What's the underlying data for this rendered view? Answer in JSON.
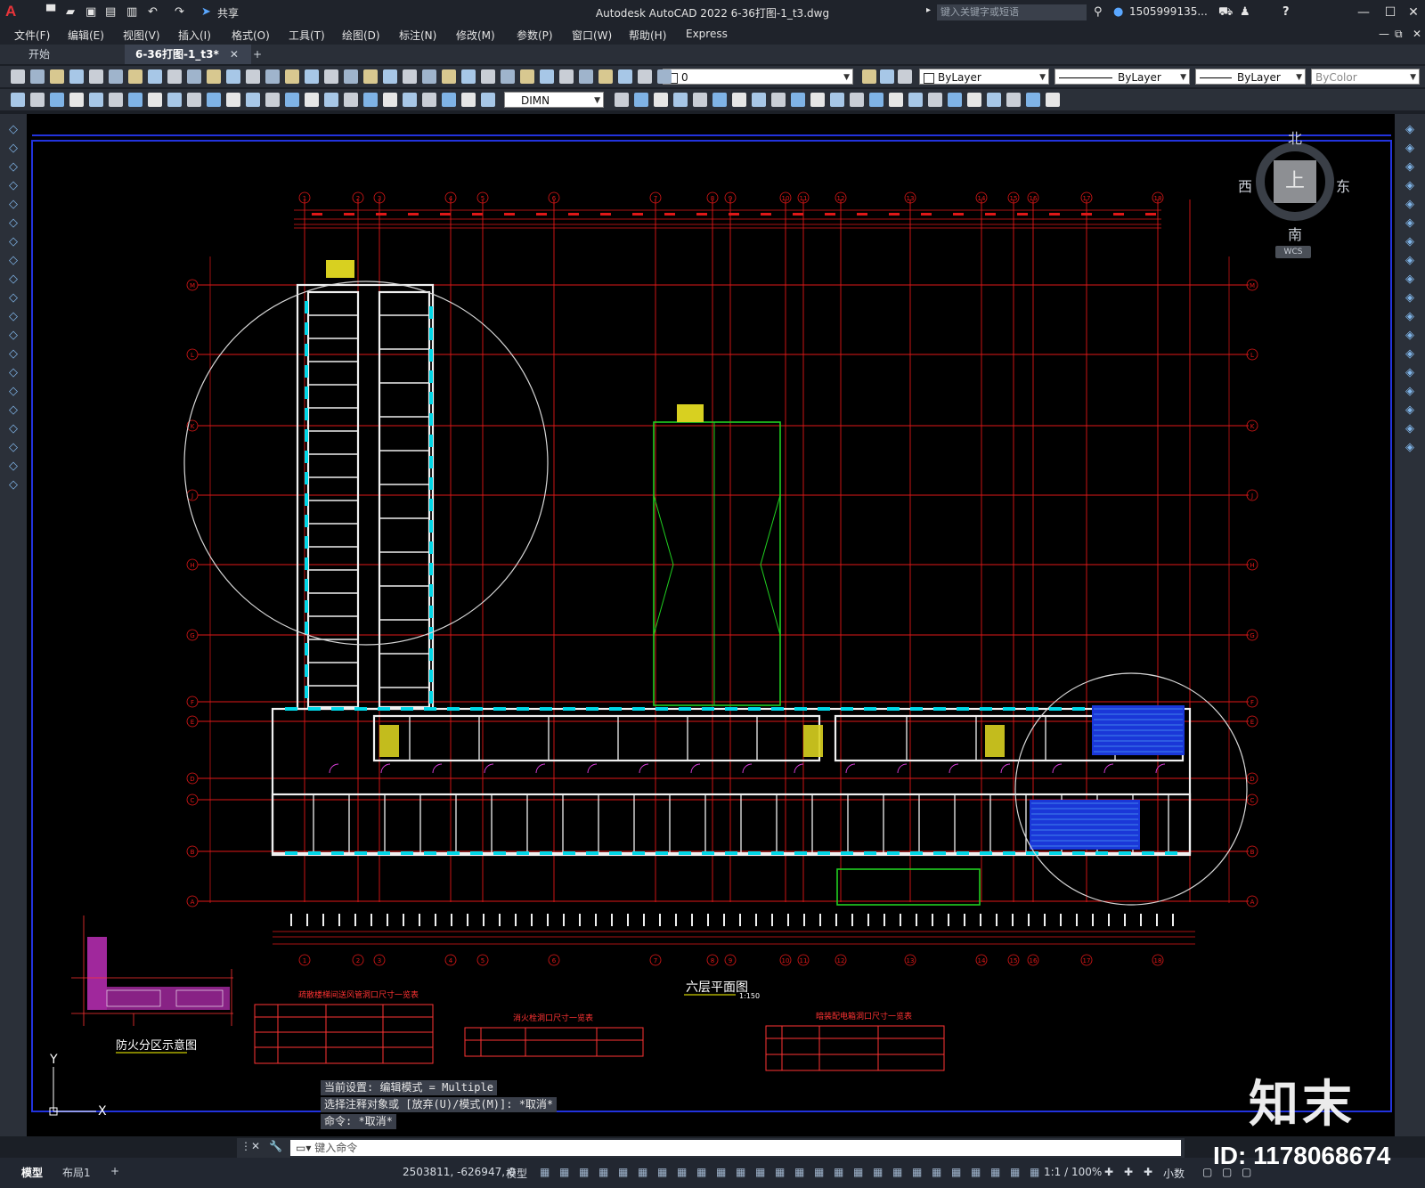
{
  "titlebar": {
    "app_logo": "A",
    "share_label": "共享",
    "title": "Autodesk AutoCAD 2022    6-36打图-1_t3.dwg",
    "search_placeholder": "键入关键字或短语",
    "user": "1505999135...",
    "help": "?"
  },
  "menu": [
    "文件(F)",
    "编辑(E)",
    "视图(V)",
    "插入(I)",
    "格式(O)",
    "工具(T)",
    "绘图(D)",
    "标注(N)",
    "修改(M)",
    "参数(P)",
    "窗口(W)",
    "帮助(H)",
    "Express"
  ],
  "tabs": {
    "start": "开始",
    "active": "6-36打图-1_t3*",
    "close": "✕",
    "add": "+"
  },
  "toolbar": {
    "layer": "0",
    "color": "ByLayer",
    "linetype": "ByLayer",
    "lineweight": "ByLayer",
    "plotstyle": "ByColor",
    "dimstyle": "DIMN"
  },
  "viewcube": {
    "north": "北",
    "south": "南",
    "east": "东",
    "west": "西",
    "top": "上",
    "wcs": "WCS"
  },
  "drawing": {
    "plan_title": "六层平面图",
    "plan_scale": "1:150",
    "fire_zone_title": "防火分区示意图",
    "table1_title": "疏散楼梯间送风管洞口尺寸一览表",
    "table2_title": "消火栓洞口尺寸一览表",
    "table3_title": "暗装配电箱洞口尺寸一览表",
    "axis_numbers": [
      "1",
      "2",
      "3",
      "4",
      "5",
      "6",
      "7",
      "8",
      "9",
      "10",
      "11",
      "12",
      "13",
      "14",
      "15",
      "16",
      "17",
      "18"
    ],
    "axis_letters": [
      "M",
      "L",
      "K",
      "J",
      "H",
      "G",
      "F",
      "E",
      "D",
      "C",
      "B",
      "A"
    ],
    "ucs_y": "Y",
    "ucs_x": "X"
  },
  "command": {
    "history": [
      "当前设置: 编辑模式 = Multiple",
      "选择注释对象或 [放弃(U)/模式(M)]: *取消*",
      "命令: *取消*"
    ],
    "placeholder": "键入命令"
  },
  "statusbar": {
    "model_tab": "模型",
    "layout_tab": "布局1",
    "add_tab": "+",
    "coords": "2503811, -626947, 0",
    "mode": "模型",
    "scale": "1:1 / 100%",
    "units": "小数"
  },
  "watermark": {
    "logo": "知末",
    "id": "ID: 1178068674"
  }
}
